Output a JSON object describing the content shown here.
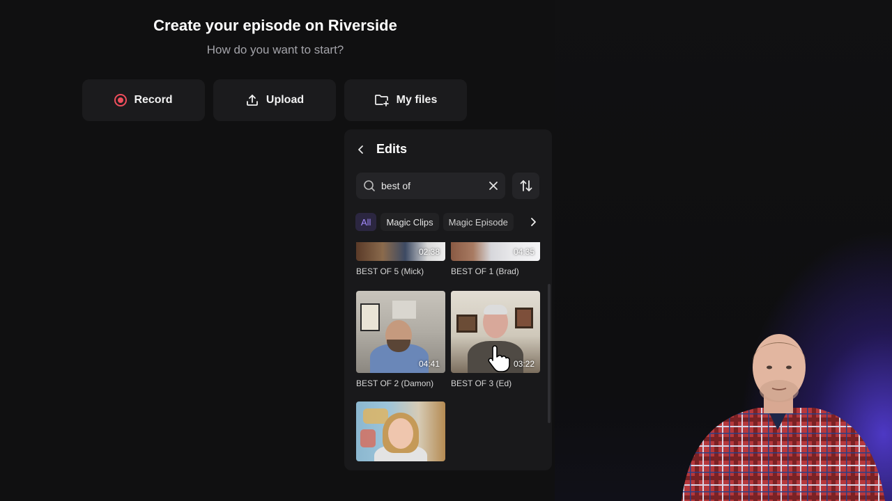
{
  "header": {
    "title": "Create your episode on Riverside",
    "subtitle": "How do you want to start?"
  },
  "start_options": [
    {
      "label": "Record",
      "icon": "record-icon"
    },
    {
      "label": "Upload",
      "icon": "upload-icon"
    },
    {
      "label": "My files",
      "icon": "folder-plus-icon"
    }
  ],
  "panel": {
    "title": "Edits",
    "search": {
      "value": "best of"
    },
    "filters": [
      {
        "label": "All",
        "active": true
      },
      {
        "label": "Magic Clips",
        "active": false
      },
      {
        "label": "Magic Episode",
        "active": false
      }
    ],
    "items": [
      {
        "label": "BEST OF 5 (Mick)",
        "duration": "02:38"
      },
      {
        "label": "BEST OF 1 (Brad)",
        "duration": "04:35"
      },
      {
        "label": "BEST OF 2 (Damon)",
        "duration": "04:41"
      },
      {
        "label": "BEST OF 3 (Ed)",
        "duration": "03:22"
      },
      {
        "label": "",
        "duration": ""
      }
    ]
  },
  "colors": {
    "accent": "#a58cff",
    "record_red": "#ef4e5c",
    "panel_bg": "#19191b"
  }
}
